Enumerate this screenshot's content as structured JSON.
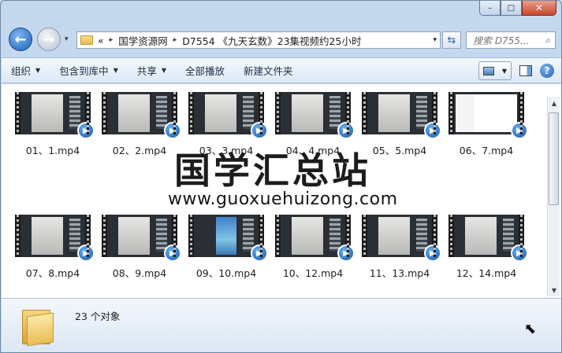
{
  "window": {
    "caption_buttons": {
      "minimize": "–",
      "maximize": "□",
      "close": "✕"
    }
  },
  "nav": {
    "back_icon": "arrow-left-icon",
    "forward_icon": "arrow-right-icon",
    "history_arrow": "▾",
    "breadcrumb_prefix": "«",
    "breadcrumbs": [
      "国学资源网",
      "D7554 《九天玄数》23集视频约25小时"
    ],
    "crumb_separator": "▸",
    "address_dropdown": "▾",
    "refresh_icon": "⇆",
    "search_placeholder": "搜索 D755...",
    "search_icon": "⌕"
  },
  "toolbar": {
    "organize": "组织",
    "include_in_library": "包含到库中",
    "share": "共享",
    "play_all": "全部播放",
    "new_folder": "新建文件夹",
    "help": "?"
  },
  "files": [
    {
      "name": "01、1.mp4",
      "thumb": "doc"
    },
    {
      "name": "02、2.mp4",
      "thumb": "doc"
    },
    {
      "name": "03、3.mp4",
      "thumb": "doc"
    },
    {
      "name": "04、4.mp4",
      "thumb": "doc"
    },
    {
      "name": "05、5.mp4",
      "thumb": "doc"
    },
    {
      "name": "06、7.mp4",
      "thumb": "colorful"
    },
    {
      "name": "07、8.mp4",
      "thumb": "doc"
    },
    {
      "name": "08、9.mp4",
      "thumb": "doc"
    },
    {
      "name": "09、10.mp4",
      "thumb": "phone"
    },
    {
      "name": "10、12.mp4",
      "thumb": "doc"
    },
    {
      "name": "11、13.mp4",
      "thumb": "doc"
    },
    {
      "name": "12、14.mp4",
      "thumb": "doc"
    }
  ],
  "watermark": {
    "main": "国学汇总站",
    "url": "www.guoxuehuizong.com"
  },
  "details": {
    "object_count": "23 个对象"
  },
  "scrollbar": {
    "up": "▲",
    "down": "▼"
  }
}
